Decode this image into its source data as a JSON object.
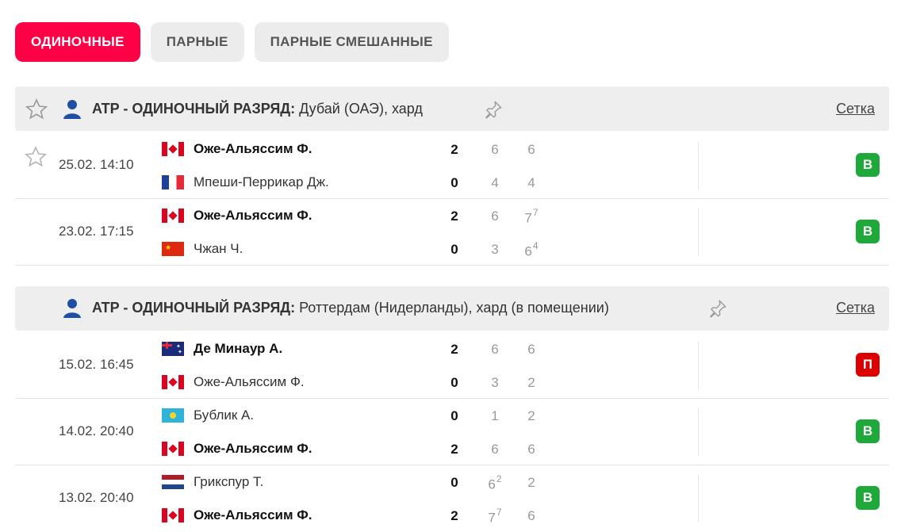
{
  "tabs": [
    {
      "label": "ОДИНОЧНЫЕ",
      "active": true
    },
    {
      "label": "ПАРНЫЕ",
      "active": false
    },
    {
      "label": "ПАРНЫЕ СМЕШАННЫЕ",
      "active": false
    }
  ],
  "leagues": [
    {
      "prefix": "ATP - ОДИНОЧНЫЙ РАЗРЯД:",
      "name": "Дубай (ОАЭ), хард",
      "bracket": "Сетка",
      "matches": [
        {
          "time": "25.02. 14:10",
          "p1": {
            "name": "Оже-Альяссим Ф.",
            "flag": "canada-flag",
            "total": "2",
            "s1": "6",
            "s2": "6",
            "s1sup": "",
            "s2sup": ""
          },
          "p2": {
            "name": "Мпеши-Перрикар Дж.",
            "flag": "france-flag",
            "total": "0",
            "s1": "4",
            "s2": "4",
            "s1sup": "",
            "s2sup": ""
          },
          "result": "В"
        },
        {
          "time": "23.02. 17:15",
          "p1": {
            "name": "Оже-Альяссим Ф.",
            "flag": "canada-flag",
            "total": "2",
            "s1": "6",
            "s2": "7",
            "s1sup": "",
            "s2sup": "7"
          },
          "p2": {
            "name": "Чжан Ч.",
            "flag": "china-flag",
            "total": "0",
            "s1": "3",
            "s2": "6",
            "s1sup": "",
            "s2sup": "4"
          },
          "result": "В"
        }
      ]
    },
    {
      "prefix": "ATP - ОДИНОЧНЫЙ РАЗРЯД:",
      "name": "Роттердам (Нидерланды), хард (в помещении)",
      "bracket": "Сетка",
      "matches": [
        {
          "time": "15.02. 16:45",
          "p1": {
            "name": "Де Минаур А.",
            "flag": "australia-flag",
            "total": "2",
            "s1": "6",
            "s2": "6",
            "s1sup": "",
            "s2sup": ""
          },
          "p2": {
            "name": "Оже-Альяссим Ф.",
            "flag": "canada-flag",
            "total": "0",
            "s1": "3",
            "s2": "2",
            "s1sup": "",
            "s2sup": ""
          },
          "result": "П"
        },
        {
          "time": "14.02. 20:40",
          "p1": {
            "name": "Бублик А.",
            "flag": "kazakhstan-flag",
            "total": "0",
            "s1": "1",
            "s2": "2",
            "s1sup": "",
            "s2sup": ""
          },
          "p2": {
            "name": "Оже-Альяссим Ф.",
            "flag": "canada-flag",
            "total": "2",
            "s1": "6",
            "s2": "6",
            "s1sup": "",
            "s2sup": ""
          },
          "result": "В"
        },
        {
          "time": "13.02. 20:40",
          "p1": {
            "name": "Грикспур Т.",
            "flag": "netherlands-flag",
            "total": "0",
            "s1": "6",
            "s2": "2",
            "s1sup": "2",
            "s2sup": ""
          },
          "p2": {
            "name": "Оже-Альяссим Ф.",
            "flag": "canada-flag",
            "total": "2",
            "s1": "7",
            "s2": "6",
            "s1sup": "7",
            "s2sup": ""
          },
          "result": "В"
        }
      ]
    }
  ],
  "colors": {
    "accent": "#ff0046",
    "win": "#1fa93a",
    "loss": "#dc0000"
  }
}
